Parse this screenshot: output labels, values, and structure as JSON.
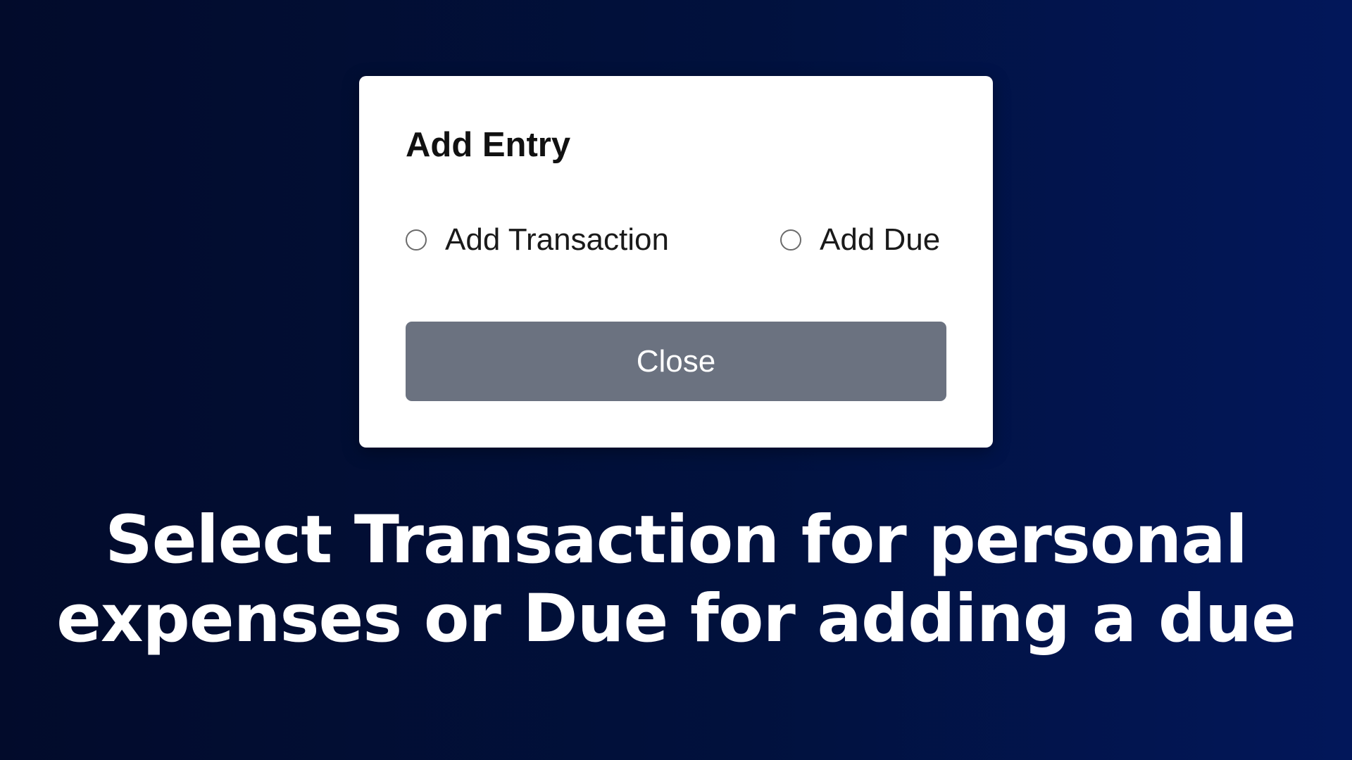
{
  "modal": {
    "title": "Add Entry",
    "options": [
      {
        "label": "Add Transaction",
        "selected": false
      },
      {
        "label": "Add Due",
        "selected": false
      }
    ],
    "close_label": "Close"
  },
  "caption": {
    "line1": "Select Transaction for personal",
    "line2": "expenses or Due for adding a due"
  },
  "colors": {
    "background_dark": "#020b2b",
    "background_light": "#02175a",
    "modal_bg": "#ffffff",
    "close_button_bg": "#6b7280",
    "caption_text": "#ffffff"
  }
}
